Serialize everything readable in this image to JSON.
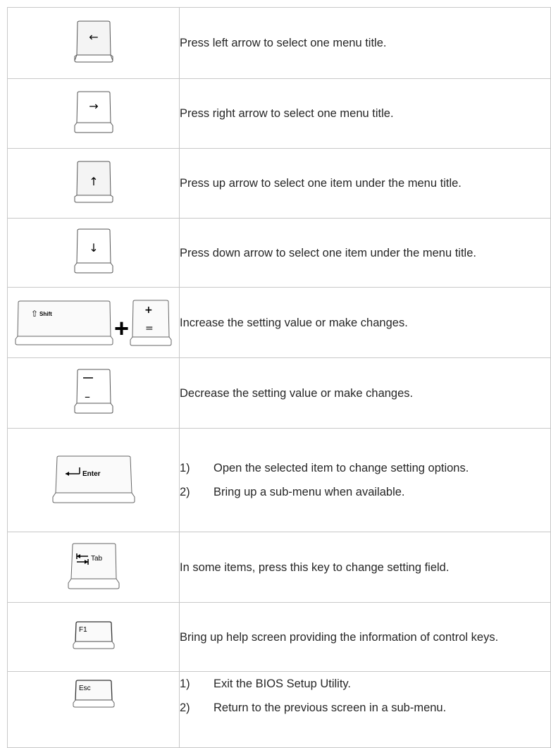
{
  "rows": [
    {
      "key_label": "←",
      "desc": "Press left arrow to select one menu title."
    },
    {
      "key_label": "→",
      "desc": "Press right arrow to select one menu title."
    },
    {
      "key_label": "↑",
      "desc": "Press up arrow to select one item under the menu title."
    },
    {
      "key_label": "↓",
      "desc": "Press down arrow to select one item under the menu title."
    },
    {
      "key_label": "Shift",
      "key_label2": "+",
      "key_label3": "=",
      "combo": "+",
      "desc": "Increase the setting value or make changes."
    },
    {
      "key_label": "–",
      "desc": "Decrease the setting value or make changes."
    },
    {
      "key_label": "Enter",
      "items": [
        {
          "num": "1)",
          "text": "Open the selected item to change setting options."
        },
        {
          "num": "2)",
          "text": "Bring up a sub-menu when available."
        }
      ]
    },
    {
      "key_label": "Tab",
      "desc": "In some items, press this key to change setting field."
    },
    {
      "key_label": "F1",
      "desc": "Bring up help screen providing the information of control keys."
    },
    {
      "key_label": "Esc",
      "items": [
        {
          "num": "1)",
          "text": "Exit the BIOS Setup Utility."
        },
        {
          "num": "2)",
          "text": "Return to the previous screen in a sub-menu."
        }
      ]
    }
  ]
}
